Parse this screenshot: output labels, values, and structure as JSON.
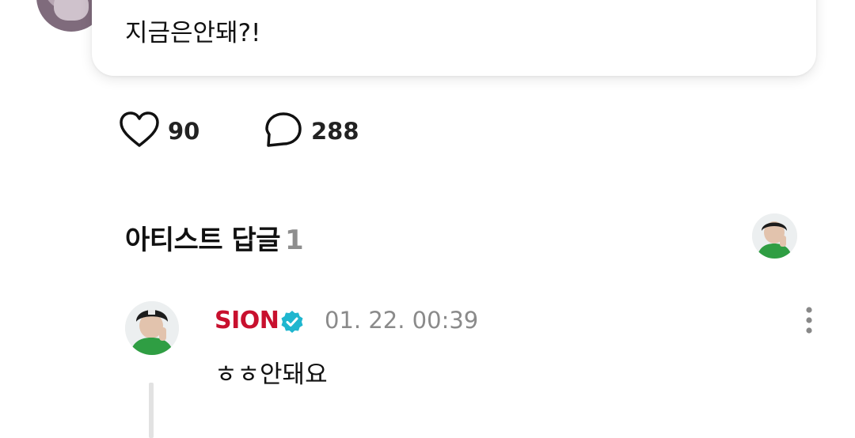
{
  "post": {
    "text": "지금은안돼?!"
  },
  "actions": {
    "like_count": "90",
    "comment_count": "288"
  },
  "artist_replies": {
    "title": "아티스트 답글",
    "count": "1"
  },
  "reply": {
    "author": "SION",
    "timestamp": "01. 22. 00:39",
    "text": "ㅎㅎ안돼요"
  },
  "colors": {
    "author_name": "#c8102e",
    "verified_badge": "#1fb6cf",
    "muted_text": "#8a8a8a"
  },
  "icons": [
    "heart-icon",
    "comment-bubble-icon",
    "verified-badge-icon",
    "more-vertical-icon"
  ]
}
